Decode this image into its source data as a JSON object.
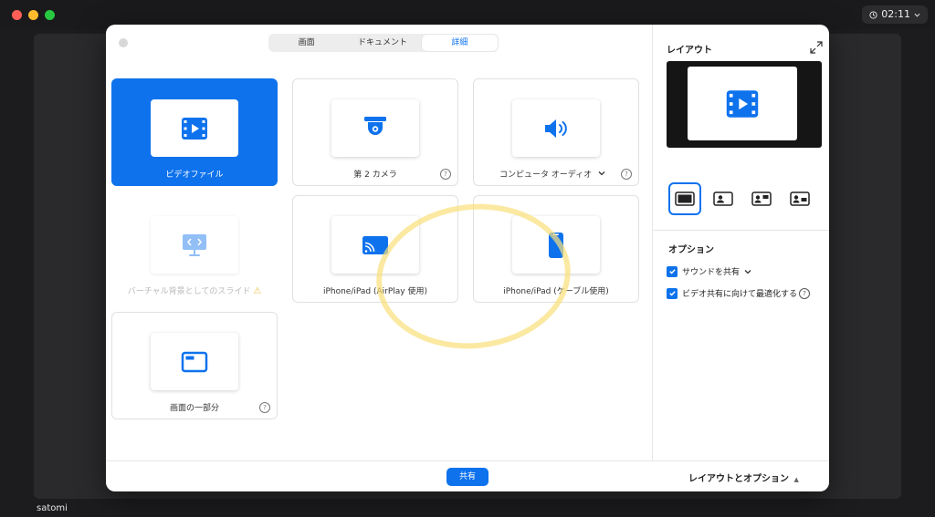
{
  "window": {
    "clock": "02:11",
    "username": "satomi"
  },
  "tabs": [
    {
      "label": "画面"
    },
    {
      "label": "ドキュメント"
    },
    {
      "label": "詳細"
    }
  ],
  "cards": [
    {
      "label": "ビデオファイル",
      "icon": "video-file-icon",
      "state": "selected"
    },
    {
      "label": "第 2 カメラ",
      "icon": "camera-icon"
    },
    {
      "label": "コンピュータ オーディオ",
      "icon": "speaker-icon"
    },
    {
      "label": "バーチャル背景としてのスライド",
      "icon": "slides-icon",
      "state": "disabled"
    },
    {
      "label": "iPhone/iPad (AirPlay 使用)",
      "icon": "airplay-icon"
    },
    {
      "label": "iPhone/iPad (ケーブル使用)",
      "icon": "phone-icon"
    },
    {
      "label": "画面の一部分",
      "icon": "window-portion-icon"
    }
  ],
  "panel": {
    "layout_title": "レイアウト",
    "options_title": "オプション",
    "options": [
      {
        "label": "サウンドを共有",
        "checked": true
      },
      {
        "label": "ビデオ共有に向けて最適化する",
        "checked": true
      }
    ]
  },
  "footer": {
    "share_label": "共有",
    "layout_toggle": "レイアウトとオプション"
  },
  "colors": {
    "accent": "#0e72ed",
    "highlight": "#f9df7a"
  }
}
